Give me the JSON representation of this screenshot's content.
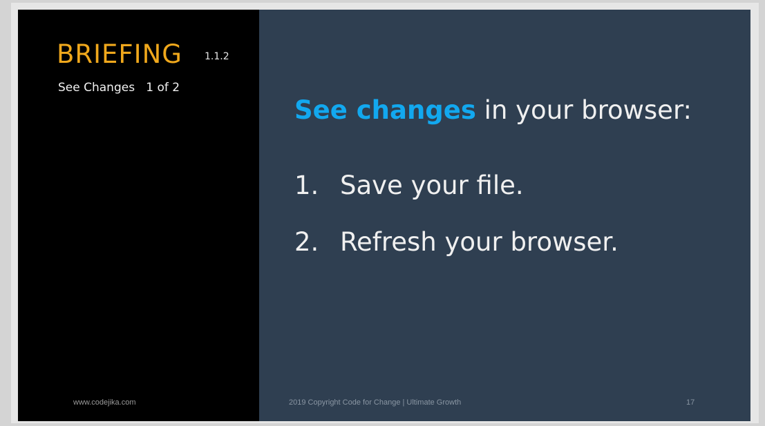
{
  "sidebar": {
    "title": "BRIEFING",
    "number": "1.1.2",
    "subtitle": "See Changes   1 of 2",
    "footer": "www.codejika.com"
  },
  "main": {
    "headline_accent": "See changes",
    "headline_rest": " in your browser:",
    "steps": [
      {
        "num": "1.",
        "text": "Save your file."
      },
      {
        "num": "2.",
        "text": "Refresh your browser."
      }
    ],
    "footer": "2019 Copyright Code for Change | Ultimate Growth",
    "page_number": "17"
  },
  "colors": {
    "title": "#f0a81c",
    "accent": "#12a8ef",
    "left_bg": "#000000",
    "right_bg": "#2f3f51"
  }
}
